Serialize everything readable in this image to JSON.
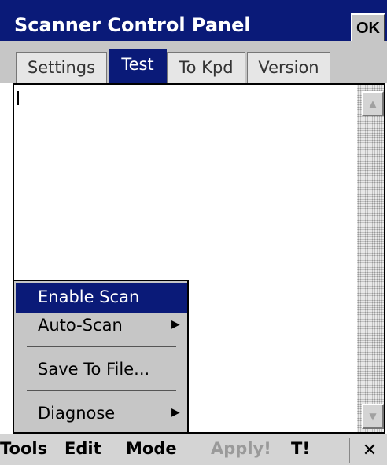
{
  "window": {
    "title": "Scanner Control Panel",
    "ok_label": "OK"
  },
  "tabs": [
    {
      "label": "Settings",
      "selected": false
    },
    {
      "label": "Test",
      "selected": true
    },
    {
      "label": "To Kpd",
      "selected": false
    },
    {
      "label": "Version",
      "selected": false
    }
  ],
  "text_area": {
    "value": ""
  },
  "context_menu": {
    "items": [
      {
        "label": "Enable Scan",
        "highlighted": true
      },
      {
        "label": "Auto-Scan",
        "submenu_arrow": "▶"
      },
      {
        "label": "Save To File..."
      },
      {
        "label": "Diagnose",
        "submenu_arrow": "▶"
      }
    ]
  },
  "menu_bar": {
    "tools": "Tools",
    "edit": "Edit",
    "mode": "Mode",
    "apply": "Apply!",
    "t": "T!",
    "close": "✕"
  },
  "icons": {
    "scroll_up": "▲",
    "scroll_down": "▼"
  },
  "colors": {
    "title_bar": "#0a1a78",
    "selection": "#0a1a78",
    "disabled_text": "#9a9a9a",
    "chrome": "#c6c6c6"
  }
}
